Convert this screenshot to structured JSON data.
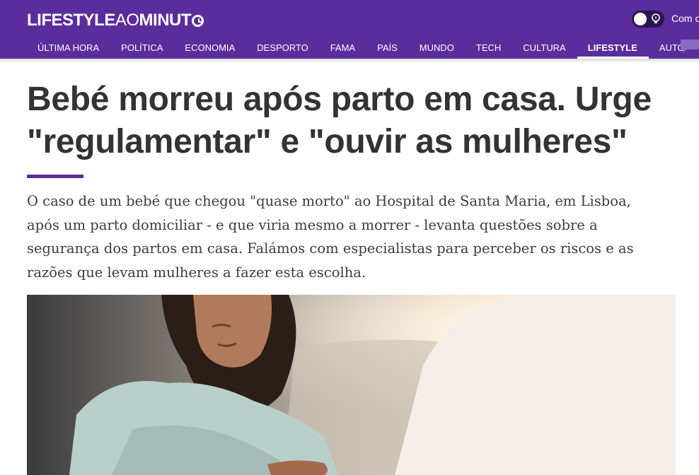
{
  "header": {
    "logo": {
      "part1": "LIFESTYLE",
      "part2": "AO",
      "part3": "MINUT"
    },
    "toggle_label": "Com o",
    "nav": [
      {
        "label": "Última Hora",
        "active": false
      },
      {
        "label": "Política",
        "active": false
      },
      {
        "label": "Economia",
        "active": false
      },
      {
        "label": "Desporto",
        "active": false
      },
      {
        "label": "Fama",
        "active": false
      },
      {
        "label": "País",
        "active": false
      },
      {
        "label": "Mundo",
        "active": false
      },
      {
        "label": "Tech",
        "active": false
      },
      {
        "label": "Cultura",
        "active": false
      },
      {
        "label": "Lifestyle",
        "active": true
      },
      {
        "label": "Auto",
        "active": false
      }
    ]
  },
  "article": {
    "headline": "Bebé morreu após parto em casa. Urge \"regulamentar\" e \"ouvir as mulheres\"",
    "lead": "O caso de um bebé que chegou \"quase morto\" ao Hospital de Santa Maria, em Lisboa, após um parto domiciliar - e que viria mesmo a morrer - levanta questões sobre a segurança dos partos em casa. Falámos com especialistas para perceber os riscos e as razões que levam mulheres a fazer esta escolha."
  },
  "icons": [
    "clock-icon",
    "lightbulb-icon",
    "chat-icon"
  ],
  "colors": {
    "brand": "#5b2d9c",
    "text": "#333333"
  }
}
